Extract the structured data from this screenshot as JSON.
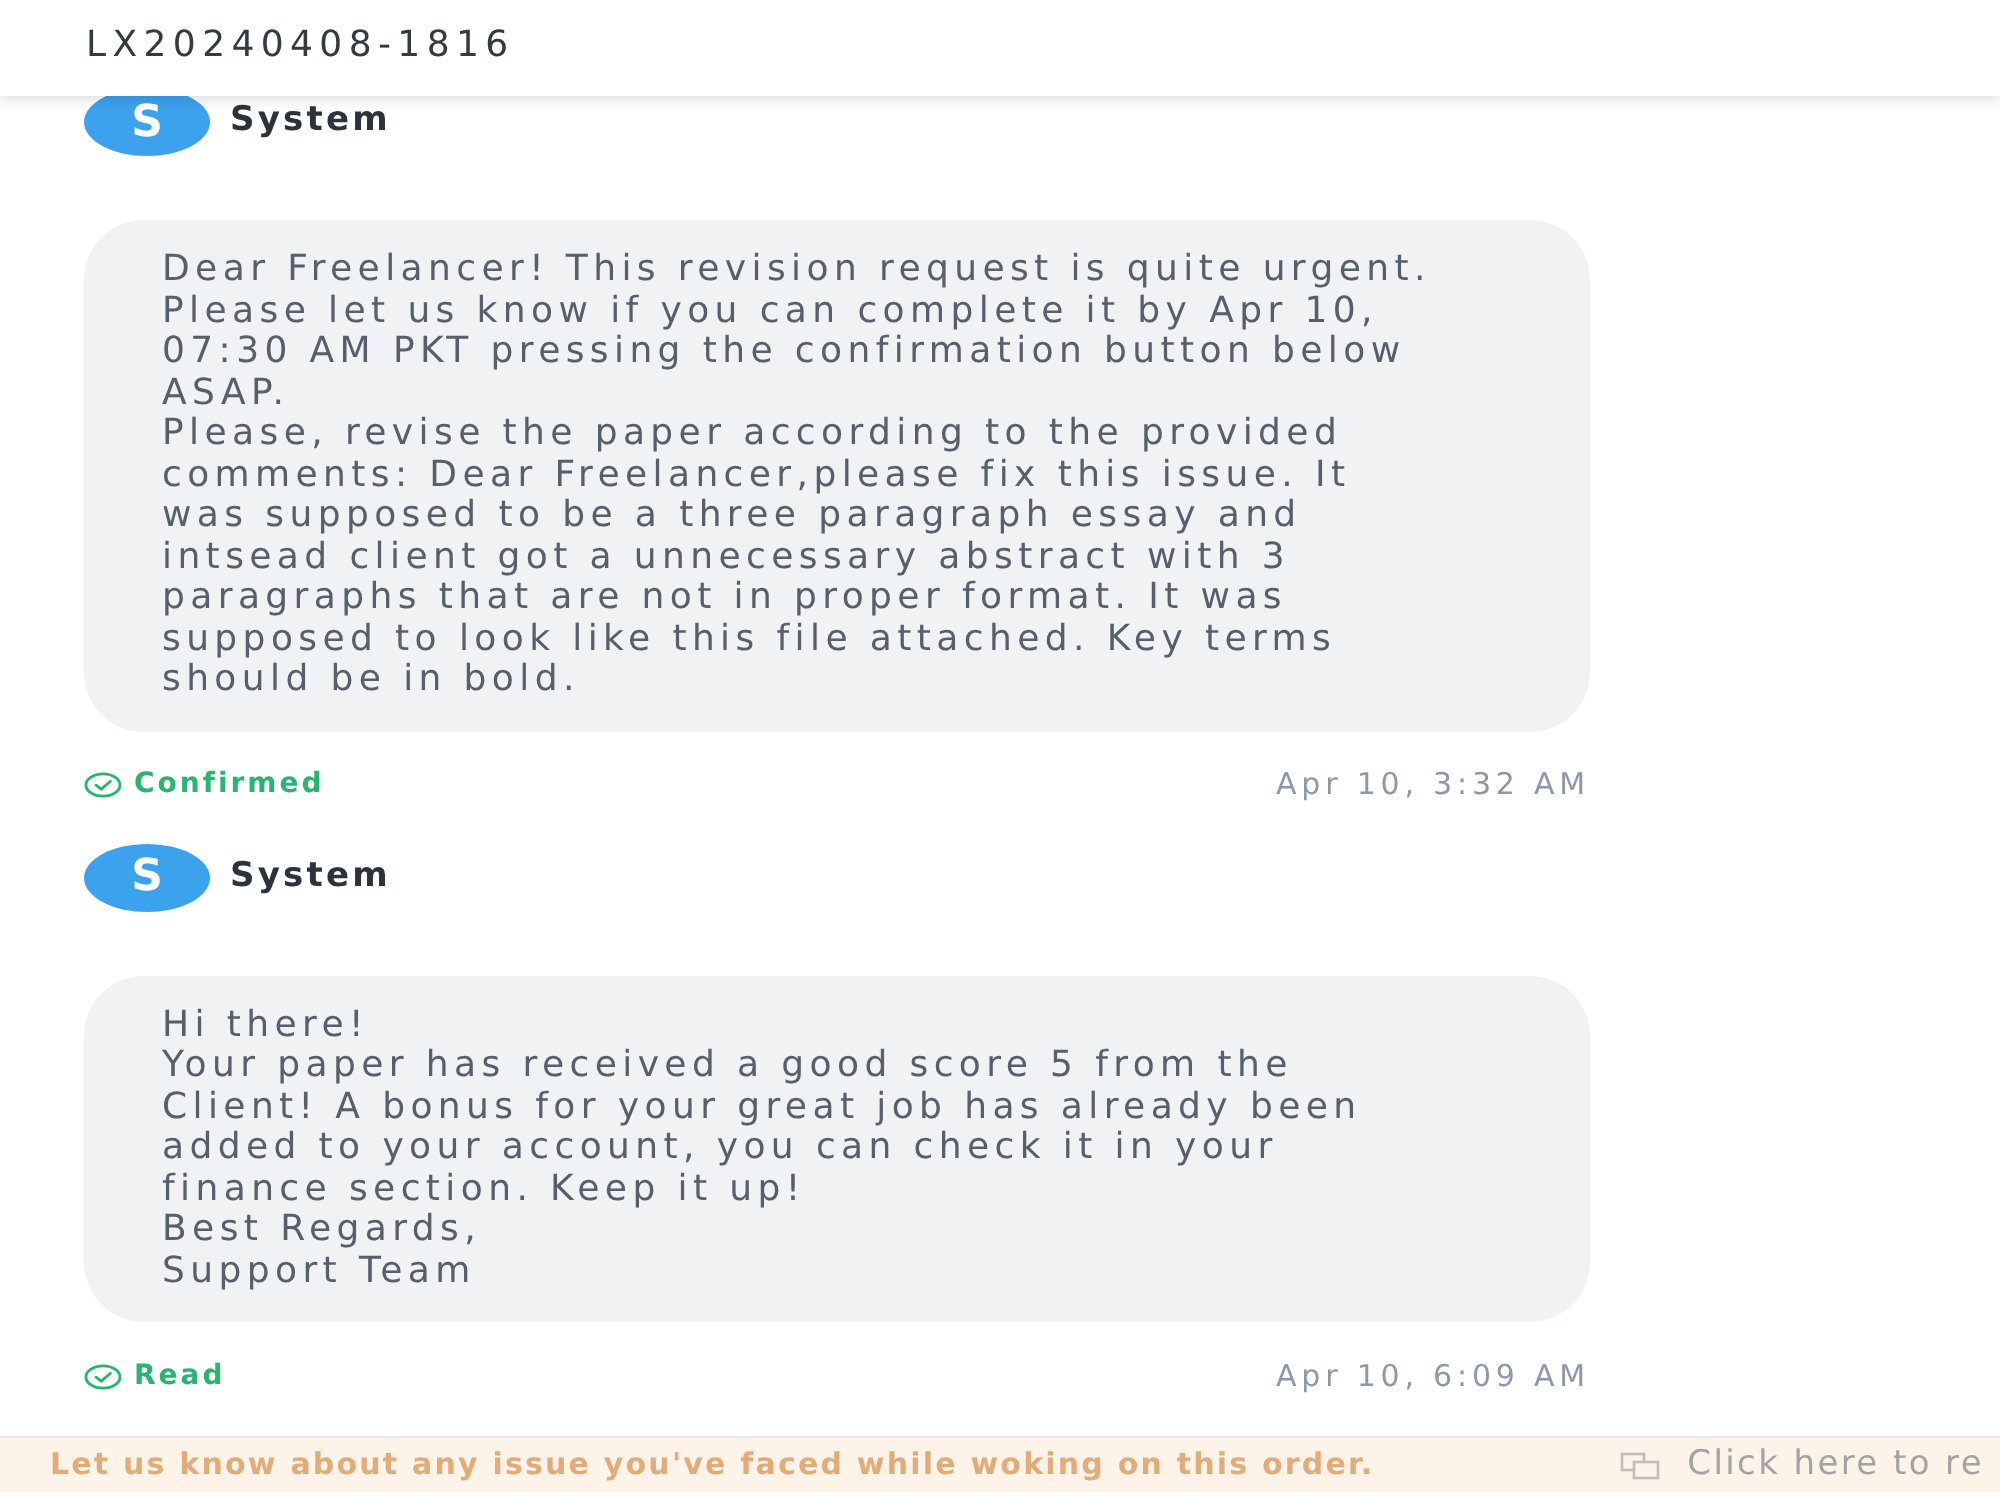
{
  "header": {
    "title": "LX20240408-1816"
  },
  "messages": [
    {
      "sender": "System",
      "avatar": "S",
      "paragraphs": [
        "Dear Freelancer! This revision request is quite urgent. Please let us know if you can complete it by Apr 10, 07:30 AM PKT pressing the confirmation button below ASAP.",
        "Please, revise the paper according to the provided comments: Dear Freelancer,please fix this issue. It was supposed to be a three paragraph essay and intsead client got a unnecessary abstract with 3 paragraphs that are not in proper format. It was supposed to look like this file attached. Key terms should be in bold."
      ],
      "status": "Confirmed",
      "time": "Apr 10, 3:32 AM"
    },
    {
      "sender": "System",
      "avatar": "S",
      "paragraphs": [
        "Hi there!",
        "Your paper has received a good score 5 from the Client! A bonus for your great job has already been added to your account, you can check it in your finance section. Keep it up!",
        "Best Regards,",
        "Support Team"
      ],
      "status": "Read",
      "time": "Apr 10, 6:09 AM"
    }
  ],
  "footer": {
    "notice": "Let us know about any issue you've faced while woking on this order.",
    "action": "Click here to re"
  }
}
